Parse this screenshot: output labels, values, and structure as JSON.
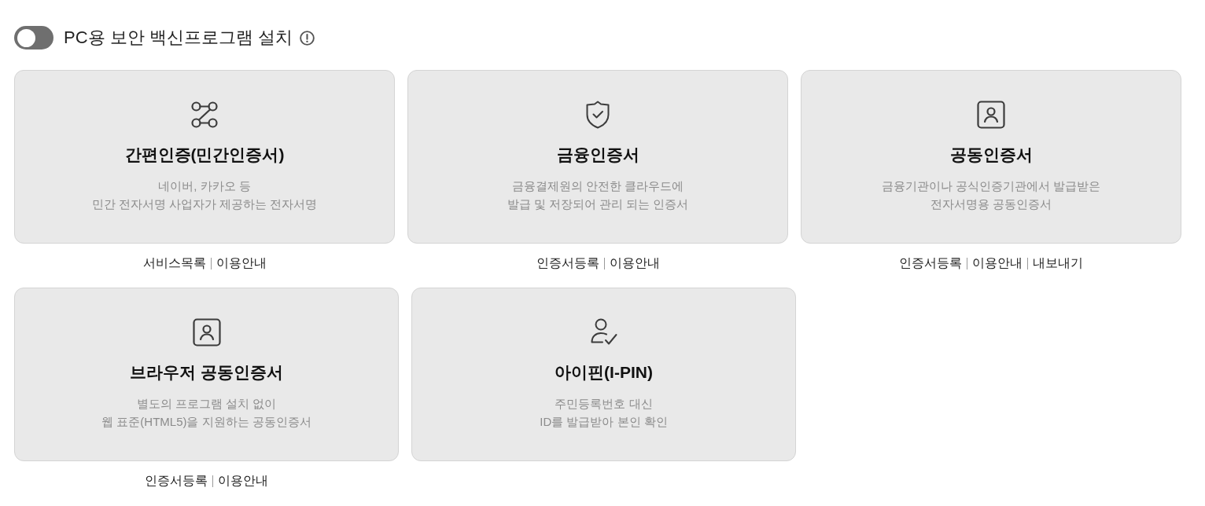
{
  "toggle": {
    "label": "PC용 보안 백신프로그램 설치",
    "on": false
  },
  "rows": [
    {
      "cards": [
        {
          "kind": "network",
          "title": "간편인증(민간인증서)",
          "description": [
            "네이버, 카카오 등",
            "민간 전자서명 사업자가 제공하는 전자서명"
          ],
          "links": [
            "서비스목록",
            "이용안내"
          ]
        },
        {
          "kind": "shield",
          "title": "금융인증서",
          "description": [
            "금융결제원의 안전한 클라우드에",
            "발급 및 저장되어 관리 되는 인증서"
          ],
          "links": [
            "인증서등록",
            "이용안내"
          ]
        },
        {
          "kind": "user-square",
          "title": "공동인증서",
          "description": [
            "금융기관이나 공식인증기관에서 발급받은",
            "전자서명용 공동인증서"
          ],
          "links": [
            "인증서등록",
            "이용안내",
            "내보내기"
          ]
        }
      ]
    },
    {
      "cards": [
        {
          "kind": "user-square",
          "title": "브라우저 공동인증서",
          "description": [
            "별도의 프로그램 설치 없이",
            "웹 표준(HTML5)을 지원하는 공동인증서"
          ],
          "links": [
            "인증서등록",
            "이용안내"
          ]
        },
        {
          "kind": "user-check",
          "title": "아이핀(I-PIN)",
          "description": [
            "주민등록번호 대신",
            "ID를 발급받아 본인 확인"
          ]
        }
      ]
    }
  ]
}
